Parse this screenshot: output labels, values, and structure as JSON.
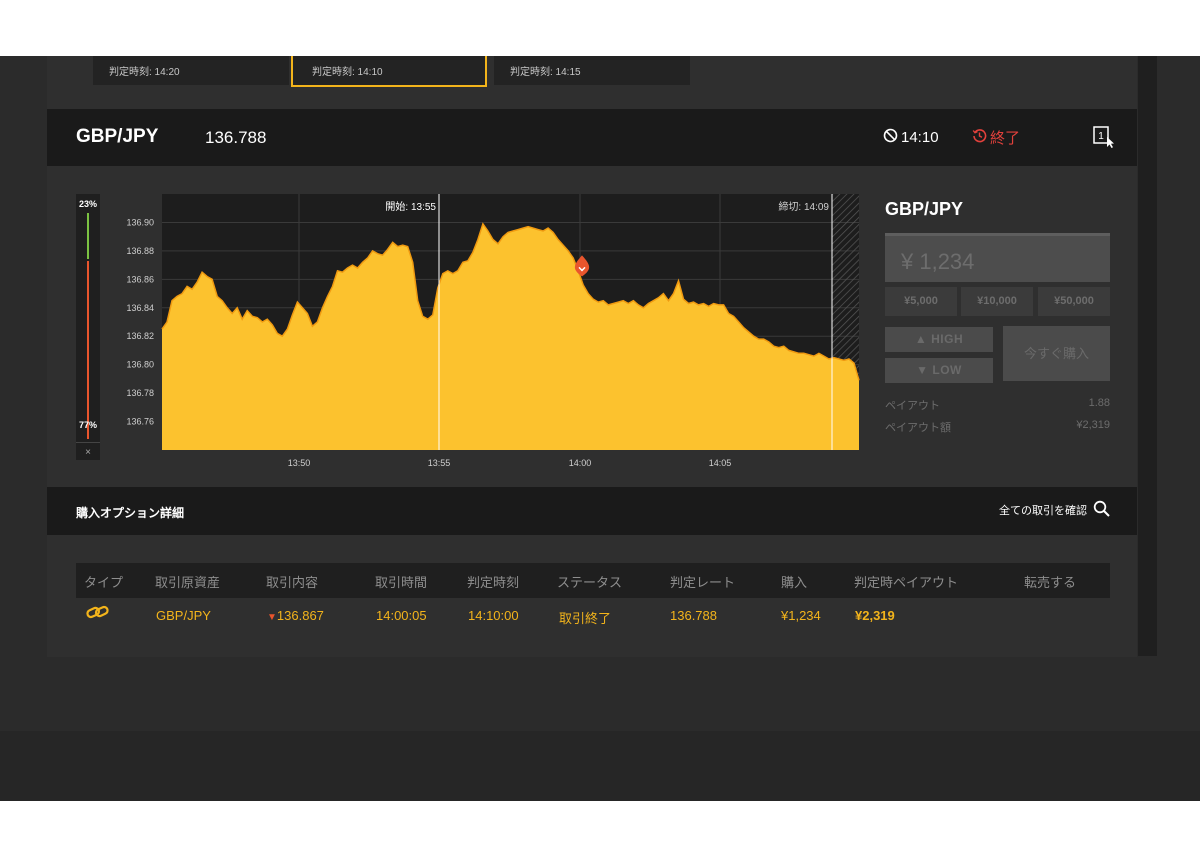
{
  "tabs": [
    {
      "label": "判定時刻: 14:20",
      "active": false
    },
    {
      "label": "判定時刻: 14:10",
      "active": true
    },
    {
      "label": "判定時刻: 14:15",
      "active": false
    }
  ],
  "header": {
    "pair": "GBP/JPY",
    "price": "136.788",
    "timer": "14:10",
    "status": "終了",
    "icons": [
      "clock-slash-icon",
      "history-icon",
      "expand-window-icon"
    ]
  },
  "sentiment": {
    "high_pct": "23%",
    "low_pct": "77%",
    "close": "×"
  },
  "chart_data": {
    "type": "area",
    "title": "",
    "x_ticks": [
      "13:50",
      "13:55",
      "14:00",
      "14:05"
    ],
    "y_ticks": [
      "136.90",
      "136.88",
      "136.86",
      "136.84",
      "136.82",
      "136.80",
      "136.78",
      "136.76"
    ],
    "ylim": [
      136.74,
      136.92
    ],
    "markers": {
      "start": "開始: 13:55",
      "close": "締切: 14:09"
    },
    "entry": {
      "time": "14:00:05",
      "rate": 136.867,
      "direction": "low"
    },
    "x": [
      0,
      5,
      10,
      15,
      20,
      25,
      30,
      35,
      40,
      45,
      50,
      55,
      60,
      65,
      70,
      75,
      80,
      85,
      90,
      95,
      100,
      105,
      110,
      115,
      120,
      125,
      130,
      135,
      140,
      145,
      150,
      155,
      160,
      165,
      170,
      175,
      180,
      185,
      190,
      195,
      200,
      205,
      210,
      215,
      220,
      225,
      230,
      235,
      240,
      245,
      250,
      255,
      260,
      265,
      270,
      275,
      280,
      285,
      290,
      295,
      300,
      305,
      310,
      315,
      320,
      325,
      330,
      335,
      340,
      345,
      350,
      355,
      360,
      365,
      370,
      375,
      380,
      385,
      390,
      395,
      400,
      405,
      410,
      415,
      420,
      425,
      430,
      435,
      440,
      445,
      450,
      455,
      460,
      465,
      470,
      475,
      480,
      485,
      490,
      495,
      500,
      505,
      510,
      515,
      520,
      525,
      530,
      535,
      540,
      545,
      550,
      555,
      560,
      565,
      570,
      575,
      580,
      585,
      590,
      595,
      600,
      605,
      610,
      615,
      620,
      625,
      630,
      635,
      640,
      645,
      650,
      655,
      660,
      665,
      670,
      675,
      680,
      685,
      690,
      695
    ],
    "values": [
      136.825,
      136.83,
      136.845,
      136.848,
      136.85,
      136.855,
      136.853,
      136.858,
      136.865,
      136.862,
      136.86,
      136.848,
      136.845,
      136.84,
      136.836,
      136.84,
      136.832,
      136.838,
      136.834,
      136.833,
      136.83,
      136.832,
      136.828,
      136.822,
      136.82,
      136.825,
      136.835,
      136.844,
      136.84,
      136.836,
      136.827,
      136.83,
      136.84,
      136.848,
      136.855,
      136.866,
      136.865,
      136.868,
      136.87,
      136.868,
      136.872,
      136.875,
      136.88,
      136.878,
      136.877,
      136.881,
      136.886,
      136.883,
      136.884,
      136.883,
      136.872,
      136.845,
      136.834,
      136.832,
      136.835,
      136.854,
      136.864,
      136.866,
      136.864,
      136.866,
      136.872,
      136.873,
      136.879,
      136.888,
      136.899,
      136.894,
      136.888,
      136.885,
      136.89,
      136.893,
      136.894,
      136.895,
      136.896,
      136.897,
      136.896,
      136.895,
      136.894,
      136.896,
      136.893,
      136.888,
      136.884,
      136.88,
      136.875,
      136.866,
      136.856,
      136.85,
      136.846,
      136.844,
      136.845,
      136.842,
      136.843,
      136.844,
      136.845,
      136.843,
      136.845,
      136.842,
      136.84,
      136.843,
      136.845,
      136.847,
      136.85,
      136.845,
      136.85,
      136.859,
      136.846,
      136.843,
      136.844,
      136.842,
      136.843,
      136.841,
      136.843,
      136.842,
      136.842,
      136.836,
      136.834,
      136.83,
      136.826,
      136.823,
      136.82,
      136.818,
      136.818,
      136.816,
      136.813,
      136.812,
      136.813,
      136.81,
      136.809,
      136.808,
      136.808,
      136.807,
      136.806,
      136.808,
      136.806,
      136.804,
      136.805,
      136.804,
      136.803,
      136.804,
      136.801,
      136.789
    ]
  },
  "purchase": {
    "pair": "GBP/JPY",
    "amount_placeholder": "¥ 1,234",
    "quick": [
      "¥5,000",
      "¥10,000",
      "¥50,000"
    ],
    "high": "HIGH",
    "low": "LOW",
    "buy_now": "今すぐ購入",
    "payout_label": "ペイアウト",
    "payout_value": "1.88",
    "payout_amount_label": "ペイアウト額",
    "payout_amount_value": "¥2,319"
  },
  "details": {
    "title": "購入オプション詳細",
    "all_trades": "全ての取引を確認",
    "columns": [
      "タイプ",
      "取引原資産",
      "取引内容",
      "取引時間",
      "判定時刻",
      "ステータス",
      "判定レート",
      "購入",
      "判定時ペイアウト",
      "転売する"
    ],
    "row": {
      "type_icon": "link-icon",
      "asset": "GBP/JPY",
      "content": "136.867",
      "trade_time": "14:00:05",
      "judge_time": "14:10:00",
      "status": "取引終了",
      "judge_rate": "136.788",
      "purchase": "¥1,234",
      "payout": "¥2,319"
    }
  },
  "colors": {
    "accent": "#f3b41b",
    "up": "#7bc242",
    "down": "#e9552d",
    "danger": "#e2413c"
  }
}
